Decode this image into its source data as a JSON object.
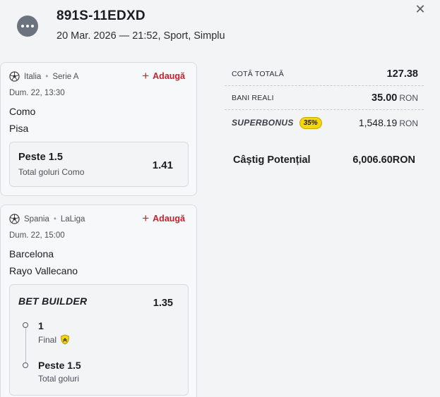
{
  "header": {
    "ticket_id": "891S-11EDXD",
    "meta": "20 Mar. 2026 — 21:52, Sport, Simplu",
    "menu_icon": "more-horizontal-icon",
    "close_icon": "close-icon",
    "close_glyph": "✕"
  },
  "add_label": "Adaugă",
  "add_glyph": "+",
  "events": [
    {
      "league_country": "Italia",
      "league_name": "Serie A",
      "time": "Dum. 22, 13:30",
      "home": "Como",
      "away": "Pisa",
      "selection": {
        "name": "Peste 1.5",
        "market": "Total goluri Como",
        "odds": "1.41"
      }
    },
    {
      "league_country": "Spania",
      "league_name": "LaLiga",
      "time": "Dum. 22, 15:00",
      "home": "Barcelona",
      "away": "Rayo Vallecano",
      "bet_builder": {
        "title": "BET BUILDER",
        "odds": "1.35",
        "legs": [
          {
            "name": "1",
            "market": "Final"
          },
          {
            "name": "Peste 1.5",
            "market": "Total goluri"
          }
        ]
      }
    }
  ],
  "summary": {
    "total_odds_label": "COTĂ TOTALĂ",
    "total_odds": "127.38",
    "real_money_label": "BANI REALI",
    "real_money": "35.00",
    "currency": "RON",
    "superbonus_label": "SUPERBONUS",
    "superbonus_pct": "35%",
    "superbonus_value": "1,548.19",
    "potential_win_label": "Câștig Potențial",
    "potential_win": "6,006.60"
  },
  "colors": {
    "accent_red": "#c8202f",
    "superbonus_yellow": "#f5d60a",
    "background": "#f3f4f6"
  }
}
